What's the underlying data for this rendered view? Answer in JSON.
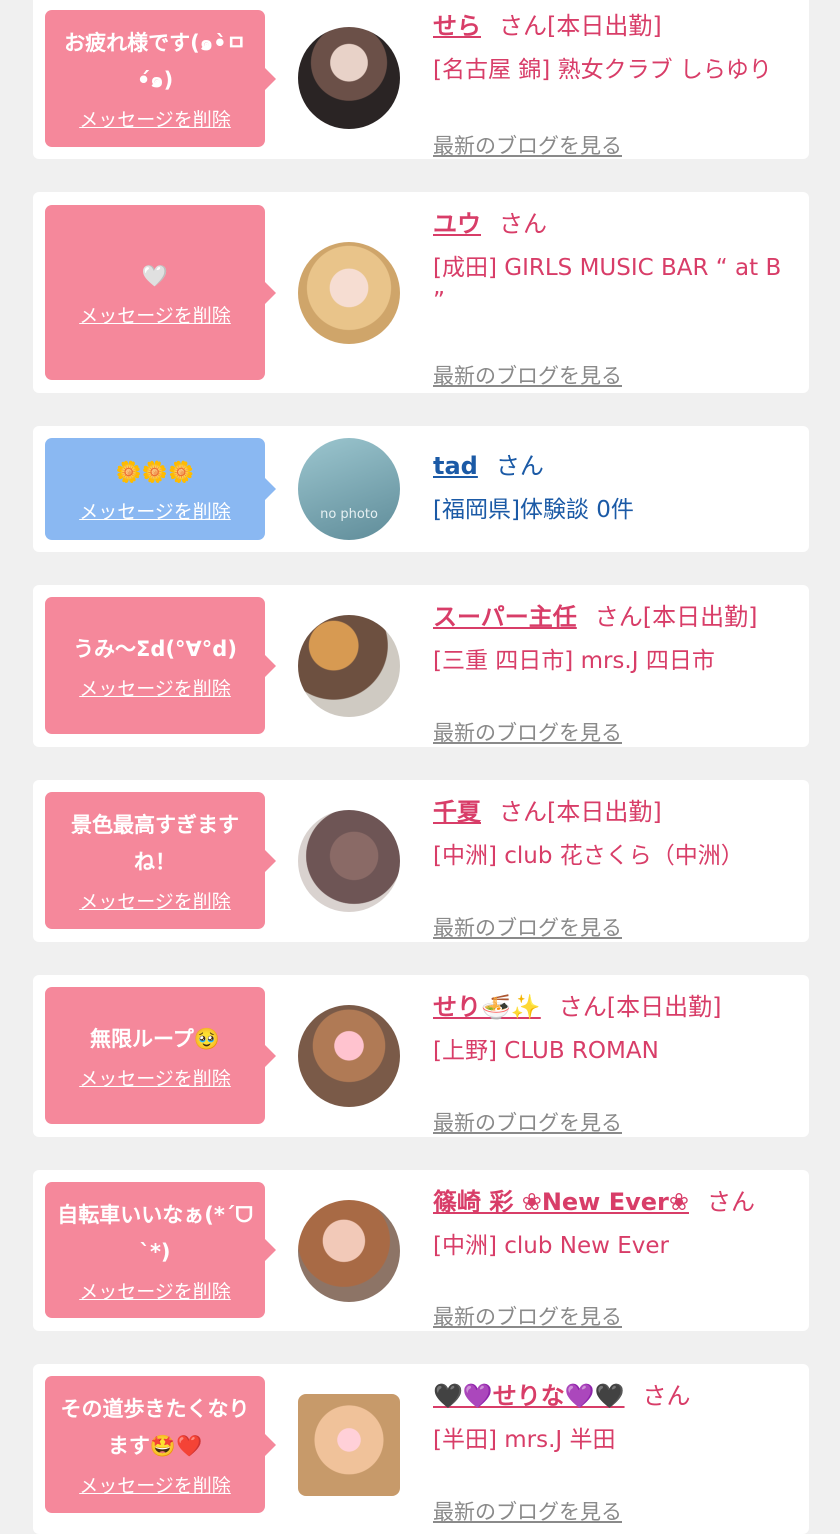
{
  "delete_label": "メッセージを削除",
  "blog_label": "最新のブログを見る",
  "san": "さん",
  "colors": {
    "pink_bubble": "#f5889b",
    "blue_bubble": "#8ab8f2",
    "pink_text": "#d83d68",
    "blue_text": "#1b5aa6"
  },
  "items": [
    {
      "message": "お疲れ様です(๑•̀ㅁ•́๑)",
      "name": "せら",
      "status": "[本日出勤]",
      "shop": "[名古屋 錦] 熟女クラブ しらゆり",
      "avatar": "avatar-photo"
    },
    {
      "message": "🤍",
      "name": "ユウ",
      "status": "",
      "shop": "[成田] GIRLS MUSIC BAR “ at B ”",
      "avatar": "avatar-photo"
    },
    {
      "message": "🌼🌼🌼",
      "name": "tad",
      "status": "",
      "shop": "[福岡県]体験談 0件",
      "avatar": "no photo"
    },
    {
      "message": "うみ〜Σd(°∀°d)",
      "name": "スーパー主任",
      "status": "[本日出勤]",
      "shop": "[三重 四日市] mrs.J 四日市",
      "avatar": "avatar-photo"
    },
    {
      "message": "景色最高すぎますね！",
      "name": "千夏",
      "status": "[本日出勤]",
      "shop": "[中洲] club 花さくら（中洲）",
      "avatar": "avatar-photo"
    },
    {
      "message": "無限ループ🥹",
      "name": "せり🍜✨",
      "status": "[本日出勤]",
      "shop": "[上野] CLUB ROMAN",
      "avatar": "avatar-photo"
    },
    {
      "message": "自転車いいなぁ(*´ᗜ`*)",
      "name": "篠崎 彩 ❀New Ever❀",
      "status": "",
      "shop": "[中洲] club New Ever",
      "avatar": "avatar-photo"
    },
    {
      "message": "その道歩きたくなります🤩❤️",
      "name": "🖤💜せりな💜🖤",
      "status": "",
      "shop": "[半田] mrs.J 半田",
      "avatar": "avatar-photo"
    }
  ]
}
